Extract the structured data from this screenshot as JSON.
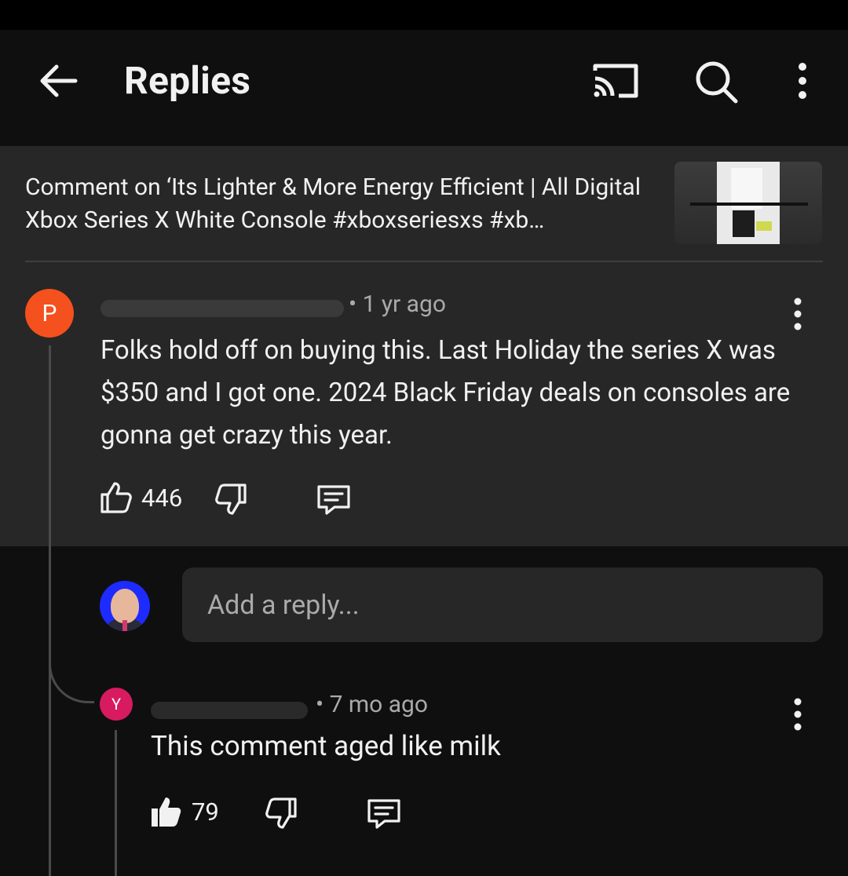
{
  "header": {
    "title": "Replies",
    "back_icon": "arrow-left-icon",
    "cast_icon": "cast-icon",
    "search_icon": "search-icon",
    "more_icon": "more-vertical-icon"
  },
  "context": {
    "text": "Comment on ‘Its Lighter & More Energy Efficient | All Digital Xbox Series X White Console #xboxseriesxs #xb…"
  },
  "comment": {
    "avatar_letter": "P",
    "meta": "• 1 yr ago",
    "text": "Folks hold off on buying this.  Last Holiday the series X was $350 and I got one.  2024 Black Friday deals on consoles are gonna get crazy this year.",
    "likes": "446"
  },
  "reply_box": {
    "placeholder": "Add a reply..."
  },
  "reply": {
    "avatar_letter": "Y",
    "meta": "• 7 mo ago",
    "text": "This comment aged like milk",
    "likes": "79"
  },
  "colors": {
    "background": "#0f0f0f",
    "surface": "#272727",
    "comment_avatar": "#f4511e",
    "reply_avatar": "#d81b60",
    "secondary_text": "#aaaaaa"
  }
}
